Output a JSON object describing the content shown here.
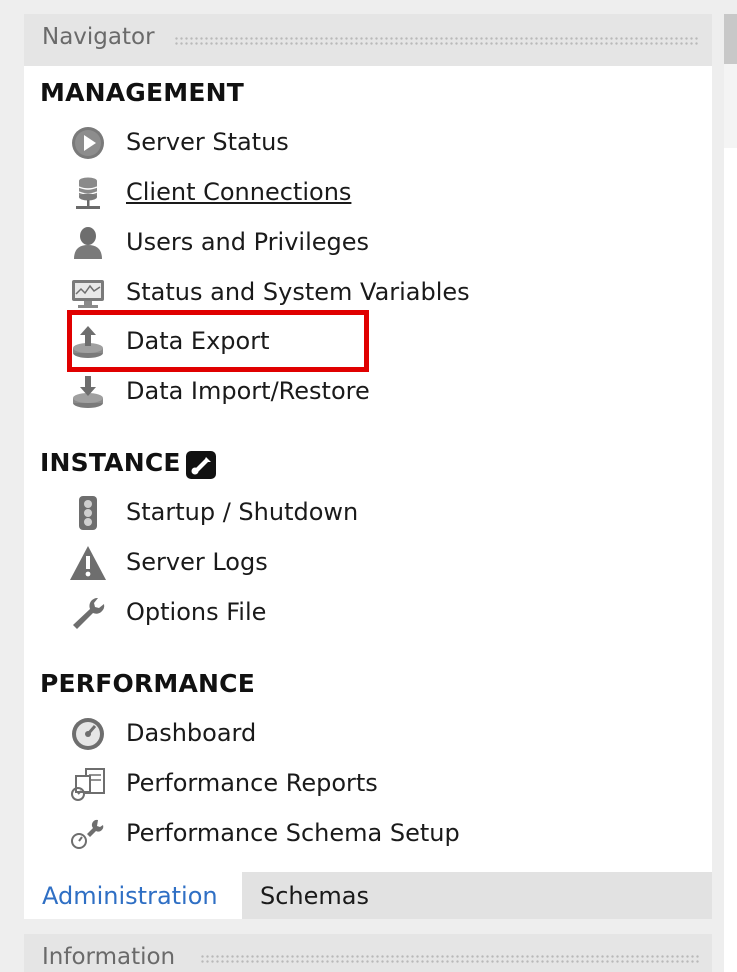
{
  "navigator": {
    "title": "Navigator",
    "sections": {
      "management": {
        "title": "MANAGEMENT",
        "items": [
          {
            "label": "Server Status",
            "icon": "play-circle-icon"
          },
          {
            "label": "Client Connections",
            "icon": "database-connection-icon"
          },
          {
            "label": "Users and Privileges",
            "icon": "user-icon"
          },
          {
            "label": "Status and System Variables",
            "icon": "monitor-icon"
          },
          {
            "label": "Data Export",
            "icon": "upload-disk-icon"
          },
          {
            "label": "Data Import/Restore",
            "icon": "download-disk-icon"
          }
        ]
      },
      "instance": {
        "title": "INSTANCE",
        "items": [
          {
            "label": "Startup / Shutdown",
            "icon": "traffic-light-icon"
          },
          {
            "label": "Server Logs",
            "icon": "warning-triangle-icon"
          },
          {
            "label": "Options File",
            "icon": "wrench-icon"
          }
        ]
      },
      "performance": {
        "title": "PERFORMANCE",
        "items": [
          {
            "label": "Dashboard",
            "icon": "gauge-icon"
          },
          {
            "label": "Performance Reports",
            "icon": "reports-icon"
          },
          {
            "label": "Performance Schema Setup",
            "icon": "schema-setup-icon"
          }
        ]
      }
    },
    "tabs": [
      {
        "label": "Administration",
        "active": true
      },
      {
        "label": "Schemas",
        "active": false
      }
    ]
  },
  "information": {
    "title": "Information"
  },
  "colors": {
    "accent": "#2f6fc4",
    "highlight": "#e00000",
    "icon_gray": "#6e6e6e"
  }
}
